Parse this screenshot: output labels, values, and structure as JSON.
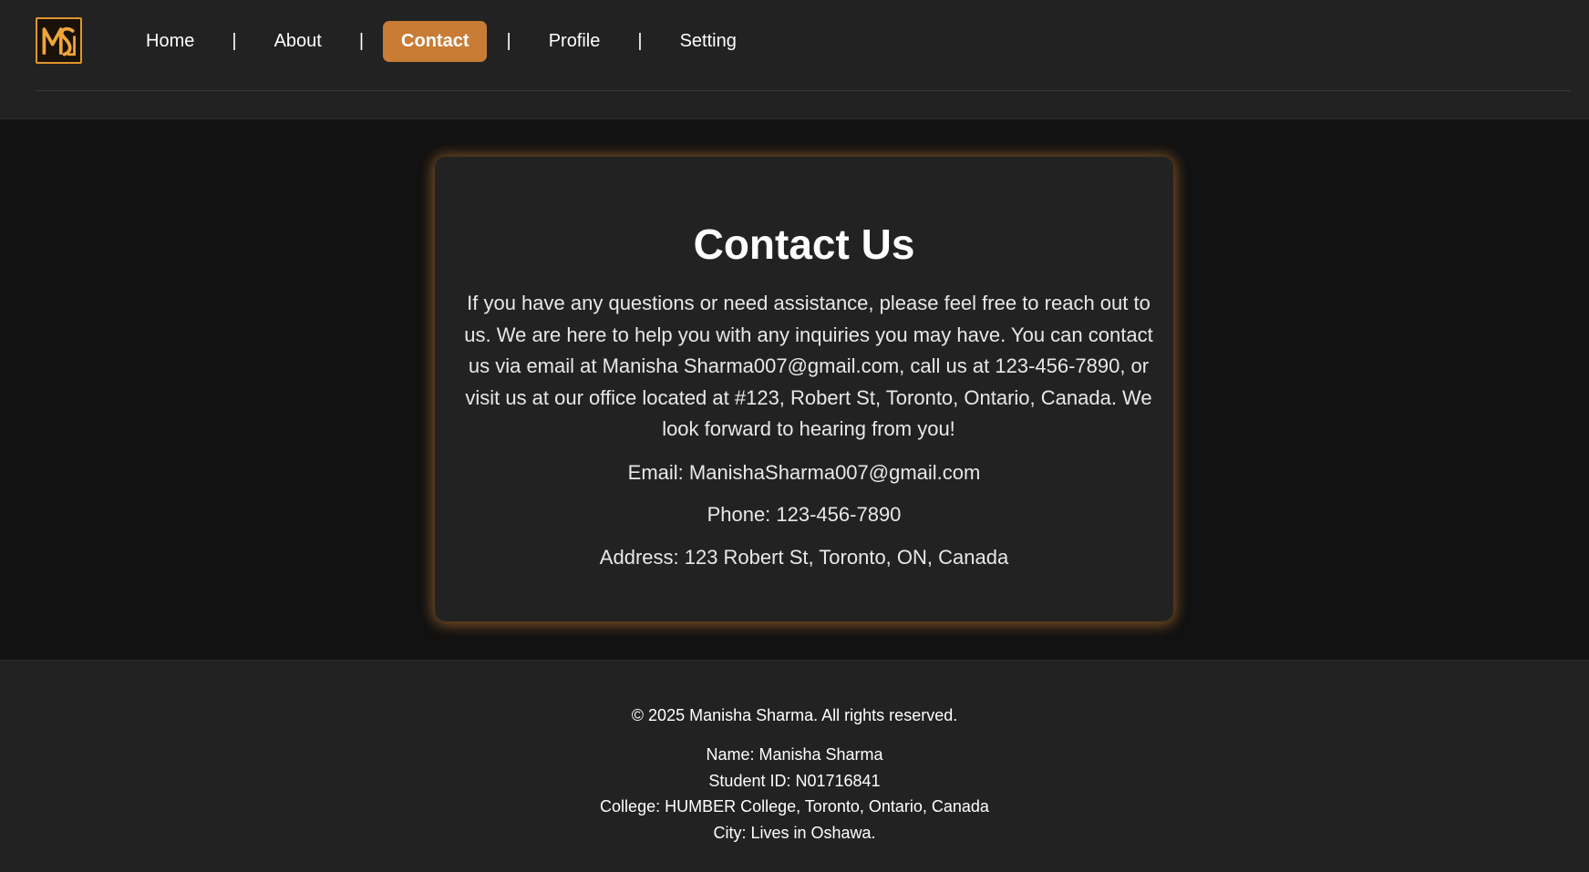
{
  "brand": {
    "logo_text": "MS",
    "accent_color": "#c87c35",
    "logo_color": "#e0962b"
  },
  "nav": {
    "items": [
      {
        "label": "Home"
      },
      {
        "label": "About"
      },
      {
        "label": "Contact",
        "active": true
      },
      {
        "label": "Profile"
      },
      {
        "label": "Setting"
      }
    ],
    "separator": "|"
  },
  "contact": {
    "title": "Contact Us",
    "description": "If you have any questions or need assistance, please feel free to reach out to us. We are here to help you with any inquiries you may have. You can contact us via email at Manisha Sharma007@gmail.com, call us at 123-456-7890, or visit us at our office located at #123, Robert St, Toronto, Ontario, Canada. We look forward to hearing from you!",
    "email": "Email: ManishaSharma007@gmail.com",
    "phone": "Phone: 123-456-7890",
    "address": "Address: 123 Robert St, Toronto, ON, Canada"
  },
  "footer": {
    "copyright": "© 2025 Manisha Sharma. All rights reserved.",
    "name": "Name: Manisha Sharma",
    "student_id": "Student ID: N01716841",
    "college": "College: HUMBER College, Toronto, Ontario, Canada",
    "city": "City: Lives in Oshawa."
  }
}
